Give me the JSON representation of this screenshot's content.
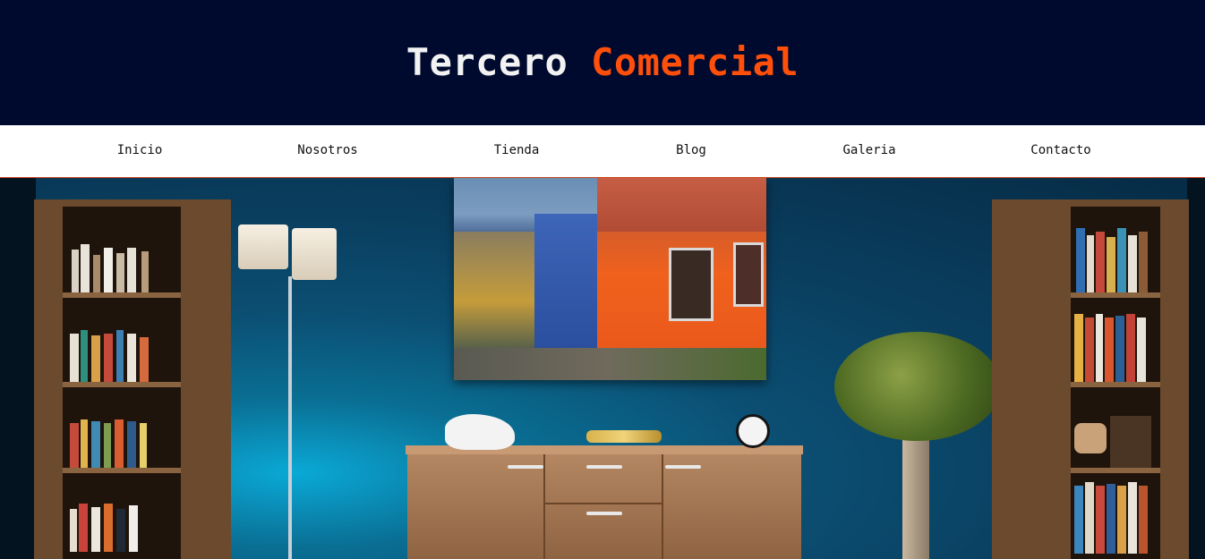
{
  "brand": {
    "word1": "Tercero",
    "word2": "Comercial",
    "word1_color": "#f2f2f2",
    "word2_color": "#ff4f0a"
  },
  "nav": {
    "items": [
      {
        "label": "Inicio"
      },
      {
        "label": "Nosotros"
      },
      {
        "label": "Tienda"
      },
      {
        "label": "Blog"
      },
      {
        "label": "Galeria"
      },
      {
        "label": "Contacto"
      }
    ]
  },
  "colors": {
    "header_bg": "#000a2e",
    "nav_bg": "#ffffff",
    "accent": "#ff4f0a"
  },
  "hero": {
    "image": "living-room-photo"
  }
}
